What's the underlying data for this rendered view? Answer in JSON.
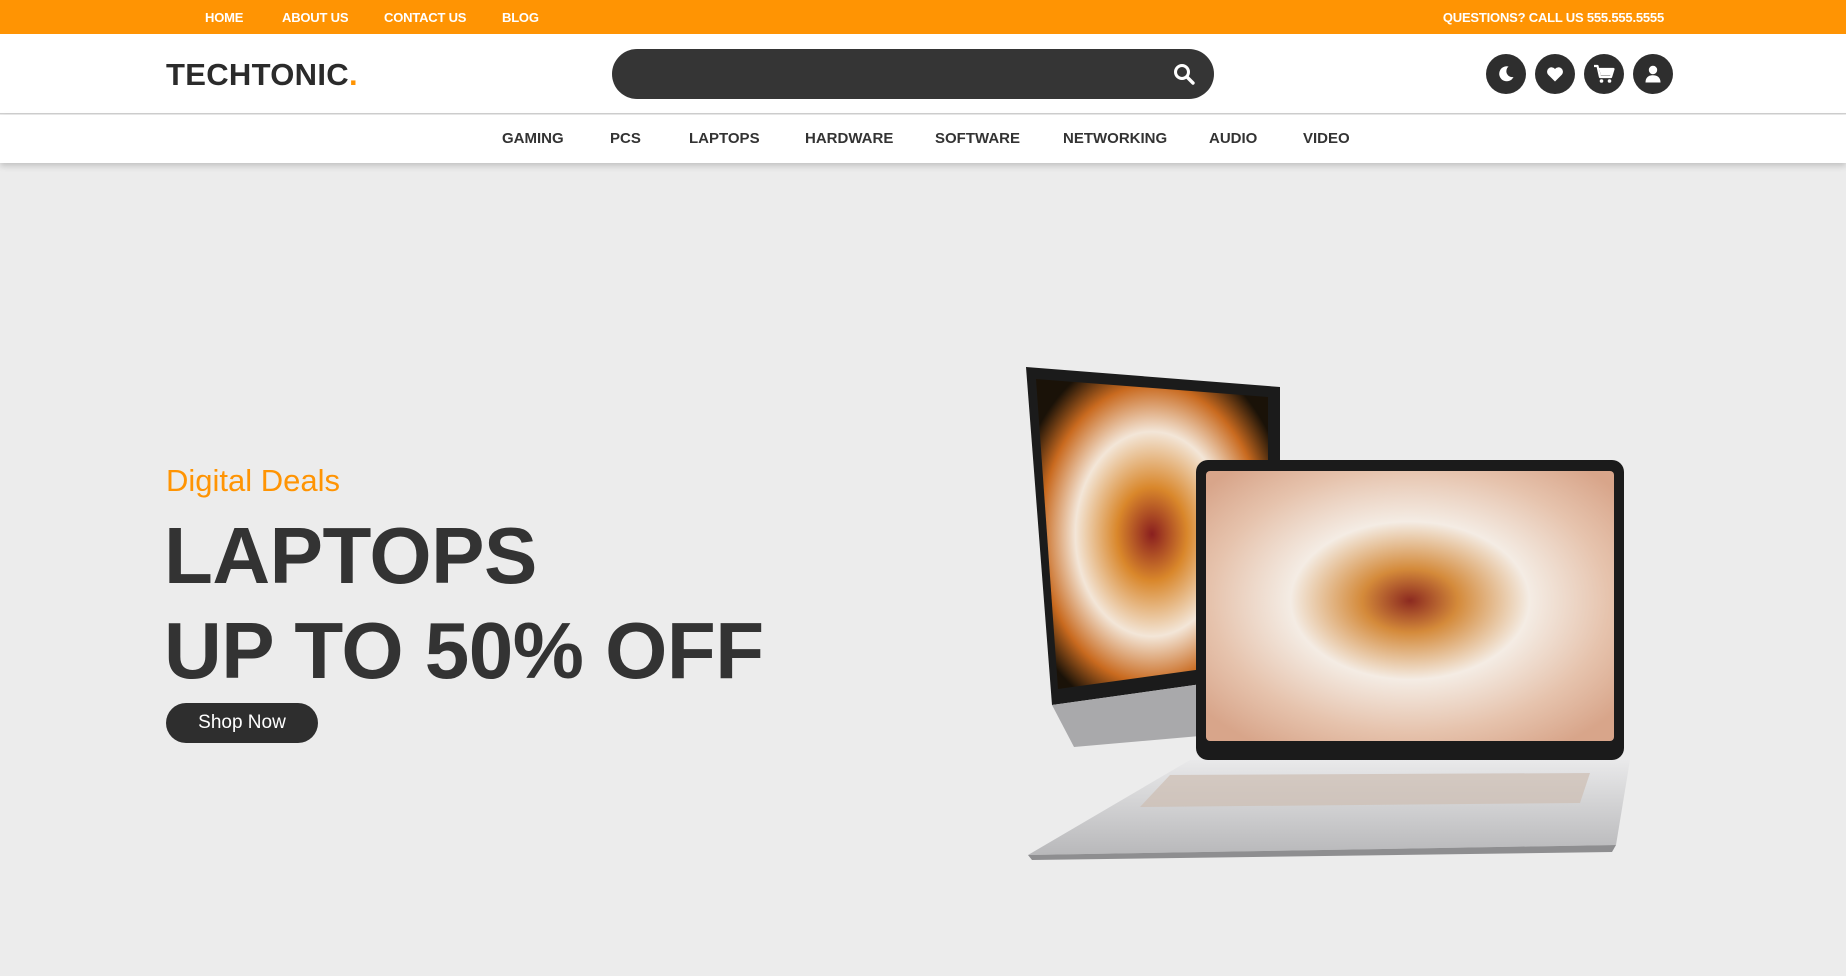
{
  "topbar": {
    "links": [
      "HOME",
      "ABOUT US",
      "CONTACT US",
      "BLOG"
    ],
    "phone": "QUESTIONS? CALL US 555.555.5555"
  },
  "header": {
    "logo_text": "TECHTONIC",
    "logo_dot": ".",
    "search_placeholder": "",
    "icons": [
      "moon-icon",
      "heart-icon",
      "cart-icon",
      "user-icon"
    ]
  },
  "categories": [
    "GAMING",
    "PCS",
    "LAPTOPS",
    "HARDWARE",
    "SOFTWARE",
    "NETWORKING",
    "AUDIO",
    "VIDEO"
  ],
  "hero": {
    "subtitle": "Digital Deals",
    "title_line1": "LAPTOPS",
    "title_line2": "UP TO 50% OFF",
    "cta": "Shop Now"
  },
  "colors": {
    "accent": "#ff9403",
    "dark": "#2e2e2e",
    "hero_bg": "#ececec"
  }
}
